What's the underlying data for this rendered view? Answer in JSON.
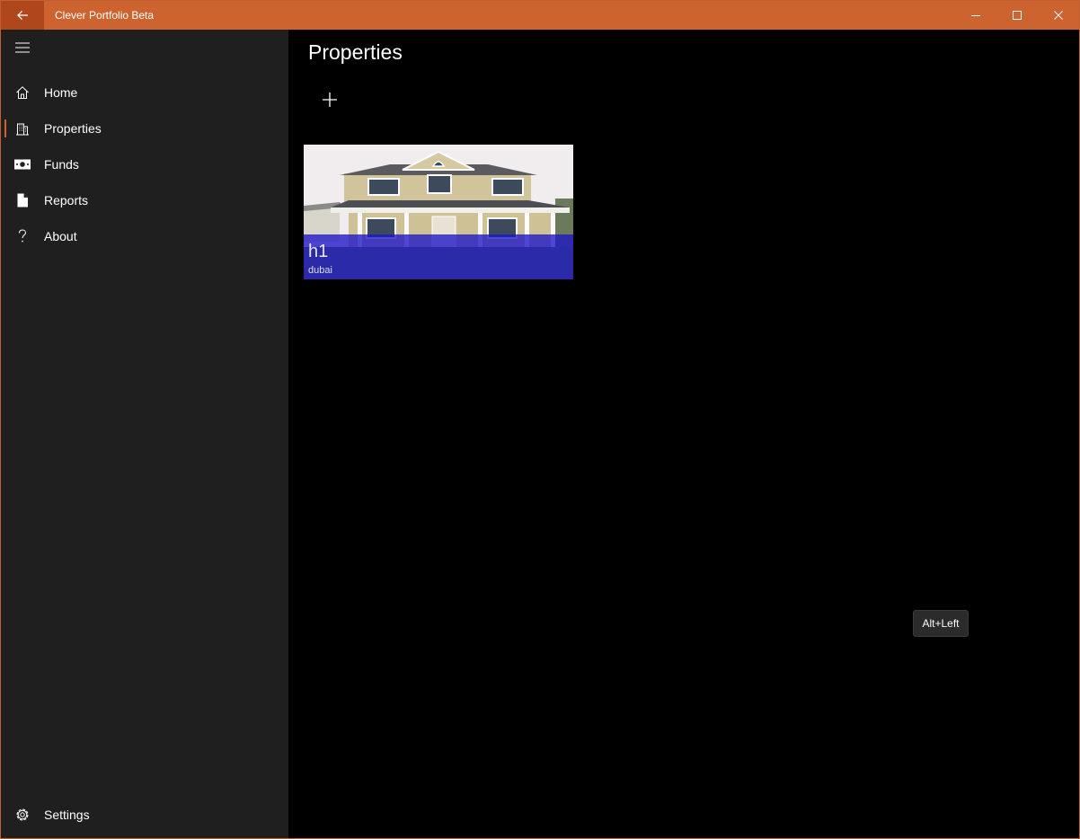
{
  "window": {
    "title": "Clever Portfolio Beta",
    "accent_color": "#cd6430",
    "back_button_color": "#b0461c",
    "caption_buttons": [
      "minimize-icon",
      "maximize-icon",
      "close-icon"
    ]
  },
  "sidebar": {
    "menu_icon": "hamburger-icon",
    "items": [
      {
        "label": "Home",
        "icon": "home-icon",
        "selected": false
      },
      {
        "label": "Properties",
        "icon": "building-icon",
        "selected": true
      },
      {
        "label": "Funds",
        "icon": "banknote-icon",
        "selected": false
      },
      {
        "label": "Reports",
        "icon": "document-icon",
        "selected": false
      },
      {
        "label": "About",
        "icon": "question-icon",
        "selected": false
      }
    ],
    "settings": {
      "label": "Settings",
      "icon": "gear-icon"
    }
  },
  "main": {
    "page_title": "Properties",
    "add_icon": "plus-icon",
    "properties": [
      {
        "name": "h1",
        "location": "dubai",
        "image": "house-photo"
      }
    ]
  },
  "tooltip": {
    "text": "Alt+Left"
  }
}
